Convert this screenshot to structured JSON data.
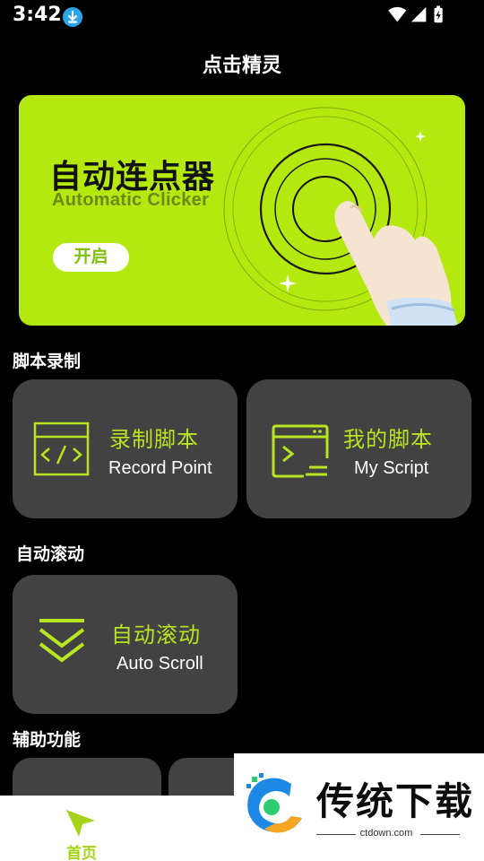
{
  "status_bar": {
    "time": "3:42"
  },
  "header": {
    "title": "点击精灵"
  },
  "banner": {
    "title": "自动连点器",
    "subtitle": "Automatic Clicker",
    "button_label": "开启"
  },
  "sections": {
    "script_recording": "脚本录制",
    "auto_scroll": "自动滚动",
    "assist_functions": "辅助功能"
  },
  "cards": {
    "record": {
      "cn": "录制脚本",
      "en": "Record Point"
    },
    "my_script": {
      "cn": "我的脚本",
      "en": "My Script"
    },
    "auto_scroll": {
      "cn": "自动滚动",
      "en": "Auto Scroll"
    }
  },
  "nav": {
    "home_label": "首页"
  },
  "watermark": {
    "brand": "传统下载",
    "url": "ctdown.com"
  },
  "colors": {
    "accent": "#b4e80e",
    "card_bg": "#424242",
    "background": "#000000"
  }
}
